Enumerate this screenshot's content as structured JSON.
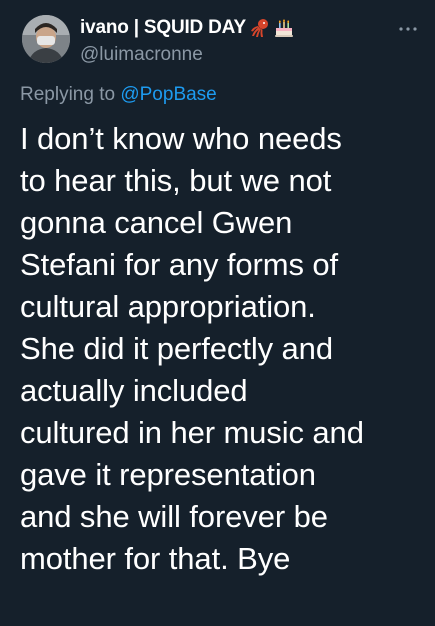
{
  "tweet": {
    "display_name": "ivano | SQUID DAY",
    "handle": "@luimacronne",
    "replying_prefix": "Replying to ",
    "replying_to": "@PopBase",
    "text": "I don’t know who needs\nto hear this, but we not\ngonna cancel Gwen\nStefani for any forms of\ncultural appropriation.\nShe did it perfectly and\nactually included\ncultured in her music and\ngave it representation\nand she will forever be\nmother for that. Bye",
    "icons": {
      "name_emoji_1": "squid-icon",
      "name_emoji_2": "birthday-cake-icon",
      "menu": "more-options-icon"
    }
  },
  "colors": {
    "background": "#15202b",
    "primary_text": "#ffffff",
    "secondary_text": "#8b98a5",
    "accent": "#1d9bf0"
  }
}
